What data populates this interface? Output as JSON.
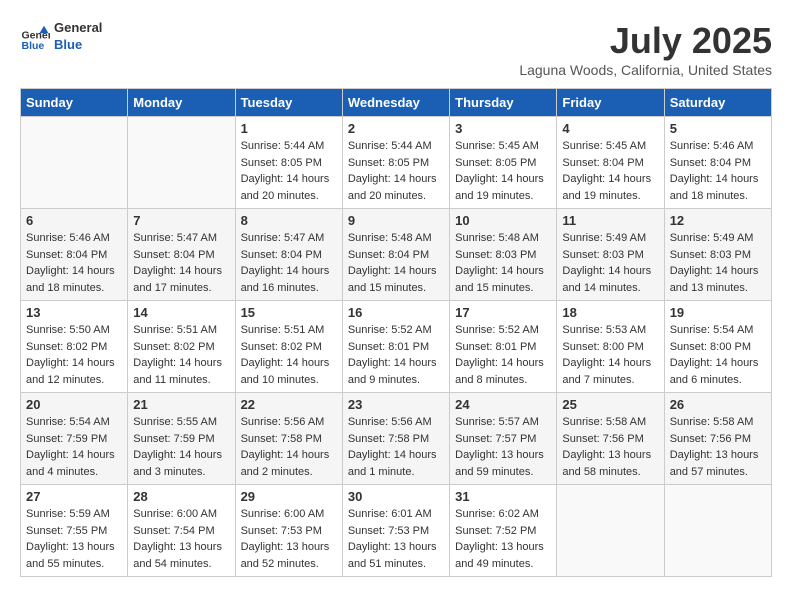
{
  "header": {
    "logo_line1": "General",
    "logo_line2": "Blue",
    "month_year": "July 2025",
    "location": "Laguna Woods, California, United States"
  },
  "days_of_week": [
    "Sunday",
    "Monday",
    "Tuesday",
    "Wednesday",
    "Thursday",
    "Friday",
    "Saturday"
  ],
  "weeks": [
    [
      {
        "day": "",
        "info": ""
      },
      {
        "day": "",
        "info": ""
      },
      {
        "day": "1",
        "info": "Sunrise: 5:44 AM\nSunset: 8:05 PM\nDaylight: 14 hours and 20 minutes."
      },
      {
        "day": "2",
        "info": "Sunrise: 5:44 AM\nSunset: 8:05 PM\nDaylight: 14 hours and 20 minutes."
      },
      {
        "day": "3",
        "info": "Sunrise: 5:45 AM\nSunset: 8:05 PM\nDaylight: 14 hours and 19 minutes."
      },
      {
        "day": "4",
        "info": "Sunrise: 5:45 AM\nSunset: 8:04 PM\nDaylight: 14 hours and 19 minutes."
      },
      {
        "day": "5",
        "info": "Sunrise: 5:46 AM\nSunset: 8:04 PM\nDaylight: 14 hours and 18 minutes."
      }
    ],
    [
      {
        "day": "6",
        "info": "Sunrise: 5:46 AM\nSunset: 8:04 PM\nDaylight: 14 hours and 18 minutes."
      },
      {
        "day": "7",
        "info": "Sunrise: 5:47 AM\nSunset: 8:04 PM\nDaylight: 14 hours and 17 minutes."
      },
      {
        "day": "8",
        "info": "Sunrise: 5:47 AM\nSunset: 8:04 PM\nDaylight: 14 hours and 16 minutes."
      },
      {
        "day": "9",
        "info": "Sunrise: 5:48 AM\nSunset: 8:04 PM\nDaylight: 14 hours and 15 minutes."
      },
      {
        "day": "10",
        "info": "Sunrise: 5:48 AM\nSunset: 8:03 PM\nDaylight: 14 hours and 15 minutes."
      },
      {
        "day": "11",
        "info": "Sunrise: 5:49 AM\nSunset: 8:03 PM\nDaylight: 14 hours and 14 minutes."
      },
      {
        "day": "12",
        "info": "Sunrise: 5:49 AM\nSunset: 8:03 PM\nDaylight: 14 hours and 13 minutes."
      }
    ],
    [
      {
        "day": "13",
        "info": "Sunrise: 5:50 AM\nSunset: 8:02 PM\nDaylight: 14 hours and 12 minutes."
      },
      {
        "day": "14",
        "info": "Sunrise: 5:51 AM\nSunset: 8:02 PM\nDaylight: 14 hours and 11 minutes."
      },
      {
        "day": "15",
        "info": "Sunrise: 5:51 AM\nSunset: 8:02 PM\nDaylight: 14 hours and 10 minutes."
      },
      {
        "day": "16",
        "info": "Sunrise: 5:52 AM\nSunset: 8:01 PM\nDaylight: 14 hours and 9 minutes."
      },
      {
        "day": "17",
        "info": "Sunrise: 5:52 AM\nSunset: 8:01 PM\nDaylight: 14 hours and 8 minutes."
      },
      {
        "day": "18",
        "info": "Sunrise: 5:53 AM\nSunset: 8:00 PM\nDaylight: 14 hours and 7 minutes."
      },
      {
        "day": "19",
        "info": "Sunrise: 5:54 AM\nSunset: 8:00 PM\nDaylight: 14 hours and 6 minutes."
      }
    ],
    [
      {
        "day": "20",
        "info": "Sunrise: 5:54 AM\nSunset: 7:59 PM\nDaylight: 14 hours and 4 minutes."
      },
      {
        "day": "21",
        "info": "Sunrise: 5:55 AM\nSunset: 7:59 PM\nDaylight: 14 hours and 3 minutes."
      },
      {
        "day": "22",
        "info": "Sunrise: 5:56 AM\nSunset: 7:58 PM\nDaylight: 14 hours and 2 minutes."
      },
      {
        "day": "23",
        "info": "Sunrise: 5:56 AM\nSunset: 7:58 PM\nDaylight: 14 hours and 1 minute."
      },
      {
        "day": "24",
        "info": "Sunrise: 5:57 AM\nSunset: 7:57 PM\nDaylight: 13 hours and 59 minutes."
      },
      {
        "day": "25",
        "info": "Sunrise: 5:58 AM\nSunset: 7:56 PM\nDaylight: 13 hours and 58 minutes."
      },
      {
        "day": "26",
        "info": "Sunrise: 5:58 AM\nSunset: 7:56 PM\nDaylight: 13 hours and 57 minutes."
      }
    ],
    [
      {
        "day": "27",
        "info": "Sunrise: 5:59 AM\nSunset: 7:55 PM\nDaylight: 13 hours and 55 minutes."
      },
      {
        "day": "28",
        "info": "Sunrise: 6:00 AM\nSunset: 7:54 PM\nDaylight: 13 hours and 54 minutes."
      },
      {
        "day": "29",
        "info": "Sunrise: 6:00 AM\nSunset: 7:53 PM\nDaylight: 13 hours and 52 minutes."
      },
      {
        "day": "30",
        "info": "Sunrise: 6:01 AM\nSunset: 7:53 PM\nDaylight: 13 hours and 51 minutes."
      },
      {
        "day": "31",
        "info": "Sunrise: 6:02 AM\nSunset: 7:52 PM\nDaylight: 13 hours and 49 minutes."
      },
      {
        "day": "",
        "info": ""
      },
      {
        "day": "",
        "info": ""
      }
    ]
  ]
}
